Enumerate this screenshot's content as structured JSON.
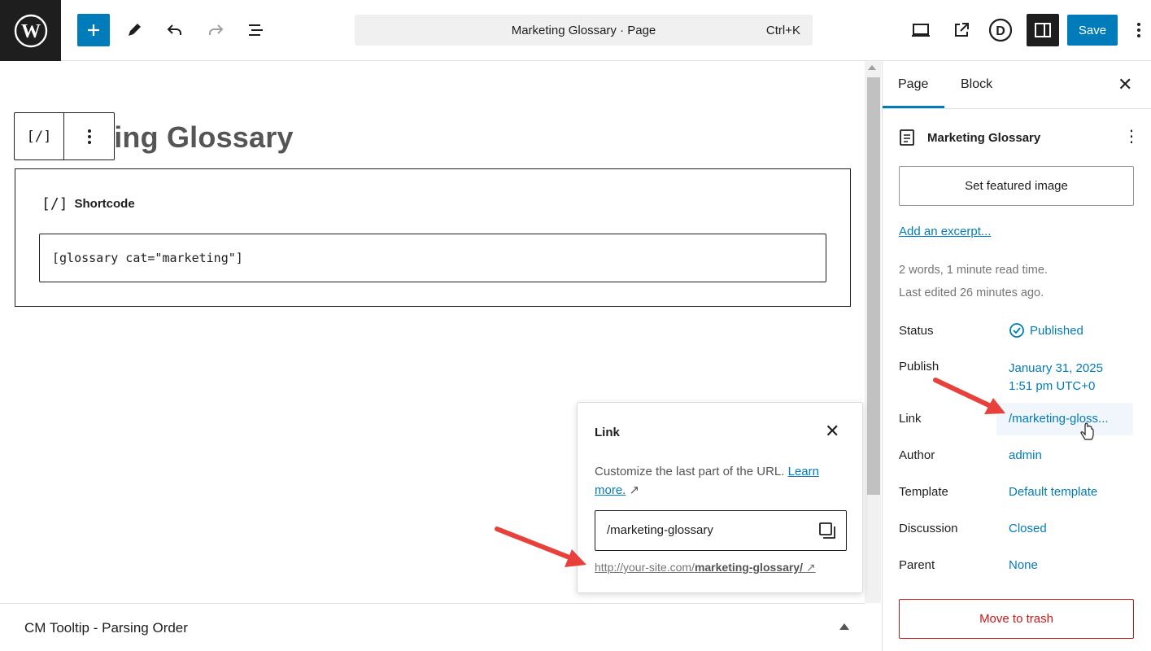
{
  "topbar": {
    "command_title": "Marketing Glossary · Page",
    "command_shortcut": "Ctrl+K",
    "save_label": "Save",
    "icons": [
      "wordpress-logo-icon",
      "plus-icon",
      "pencil-icon",
      "undo-icon",
      "redo-icon",
      "list-view-icon",
      "desktop-icon",
      "external-link-icon",
      "d-logo-icon",
      "sidebar-icon",
      "more-vertical-icon"
    ]
  },
  "editor": {
    "page_title": "Marketing Glossary",
    "page_title_visible": "ting Glossary",
    "block_toolbar_icon": "[/]",
    "block_label": "Shortcode",
    "block_icon": "[/]",
    "shortcode_value": "[glossary cat=\"marketing\"]"
  },
  "link_popover": {
    "title": "Link",
    "description": "Customize the last part of the URL.",
    "learn_more": "Learn more.",
    "slug_value": "/marketing-glossary",
    "url_base": "http://your-site.com/",
    "url_slug": "marketing-glossary/"
  },
  "metabox": {
    "title": "CM Tooltip - Parsing Order"
  },
  "sidebar": {
    "tabs": [
      "Page",
      "Block"
    ],
    "doc_title": "Marketing Glossary",
    "featured_image_label": "Set featured image",
    "excerpt_link": "Add an excerpt...",
    "word_stats": "2 words, 1 minute read time.",
    "last_edited": "Last edited 26 minutes ago.",
    "rows": [
      {
        "label": "Status",
        "value": "Published"
      },
      {
        "label": "Publish",
        "value": "January 31, 2025",
        "value2": "1:51 pm UTC+0"
      },
      {
        "label": "Link",
        "value": "/marketing-gloss..."
      },
      {
        "label": "Author",
        "value": "admin"
      },
      {
        "label": "Template",
        "value": "Default template"
      },
      {
        "label": "Discussion",
        "value": "Closed"
      },
      {
        "label": "Parent",
        "value": "None"
      }
    ],
    "trash_label": "Move to trash"
  },
  "colors": {
    "accent": "#007cba",
    "danger": "#cc1818",
    "annotation_arrow": "#e8413c"
  }
}
